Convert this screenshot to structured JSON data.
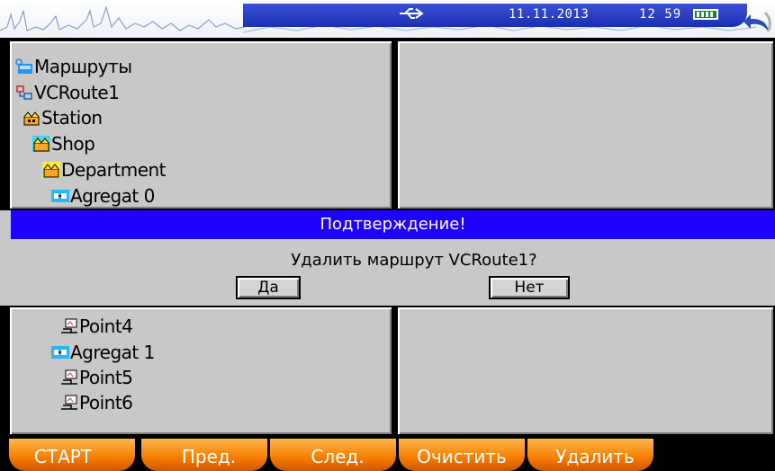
{
  "status": {
    "date": "11.11.2013",
    "time": "12  59",
    "usb_icon": "usb-icon",
    "battery_icon": "battery-icon",
    "back_icon": "back-arrow-icon"
  },
  "tree": {
    "items": [
      {
        "label": "Маршруты",
        "icon": "routes-folder-icon"
      },
      {
        "label": "VCRoute1",
        "icon": "route-icon"
      },
      {
        "label": "Station",
        "icon": "station-icon"
      },
      {
        "label": "Shop",
        "icon": "shop-icon"
      },
      {
        "label": "Department",
        "icon": "department-icon"
      },
      {
        "label": "Agregat  0",
        "icon": "aggregate-icon"
      }
    ],
    "items_lower": [
      {
        "label": "Point4",
        "icon": "point-icon"
      },
      {
        "label": "Agregat  1",
        "icon": "aggregate-icon"
      },
      {
        "label": "Point5",
        "icon": "point-icon"
      },
      {
        "label": "Point6",
        "icon": "point-icon"
      }
    ]
  },
  "dialog": {
    "title": "Подтверждение!",
    "message": "Удалить маршрут VCRoute1?",
    "yes_label": "Да",
    "no_label": "Нет"
  },
  "footer": {
    "start": "СТАРТ",
    "prev": "Пред.",
    "next": "След.",
    "clear": "Очистить",
    "delete": "Удалить"
  },
  "colors": {
    "panel": "#c8c8c8",
    "dialog_title": "#1e00ff",
    "status_bar": "#2238c4",
    "footer_button": "#f57c00"
  }
}
